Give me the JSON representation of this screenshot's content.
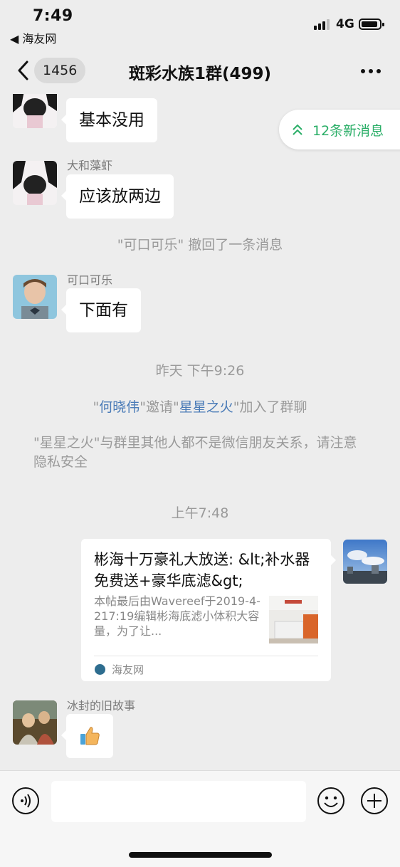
{
  "status_bar": {
    "time": "7:49",
    "back_app": "◀ 海友网",
    "network": "4G"
  },
  "nav": {
    "back_count": "1456",
    "title": "斑彩水族1群(499)"
  },
  "new_messages": "12条新消息",
  "messages": [
    {
      "sender": "",
      "text": "基本没用"
    },
    {
      "sender": "大和藻虾",
      "text": "应该放两边"
    },
    {
      "sender": "可口可乐",
      "text": "下面有"
    },
    {
      "sender": "冰封的旧故事",
      "text": ""
    }
  ],
  "system": {
    "recall": "\"可口可乐\" 撤回了一条消息",
    "time1": "昨天 下午9:26",
    "invite_q1": "\"",
    "inviter": "何晓伟",
    "invite_mid": "\"邀请\"",
    "invitee": "星星之火",
    "invite_end": "\"加入了群聊",
    "privacy": "\"星星之火\"与群里其他人都不是微信朋友关系，请注意隐私安全",
    "time2": "上午7:48"
  },
  "link_card": {
    "title": "彬海十万豪礼大放送: &lt;补水器免费送+豪华底滤&gt;",
    "description": "本帖最后由Wavereef于2019-4-217:19编辑彬海底滤小体积大容量，为了让...",
    "source": "海友网"
  },
  "colors": {
    "accent_green": "#2aae67",
    "link_blue": "#4a7bb7",
    "bg": "#ededed"
  }
}
